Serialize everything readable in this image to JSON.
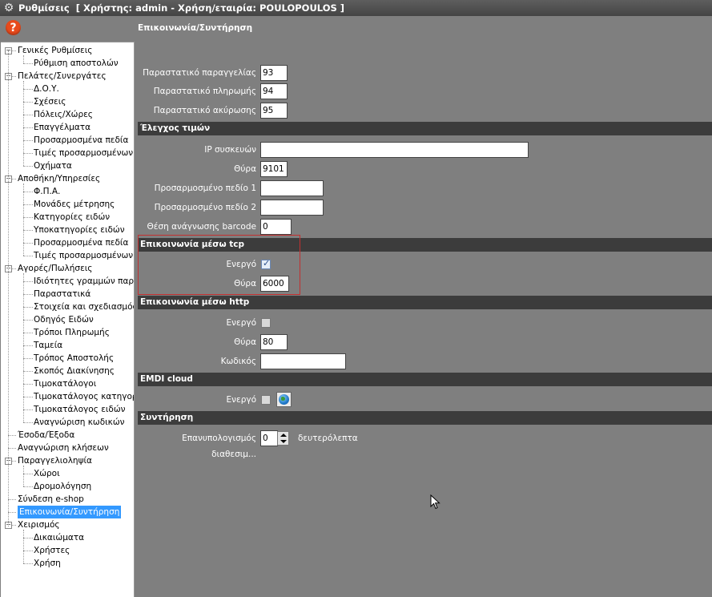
{
  "window": {
    "title": "Ρυθμίσεις",
    "subtitle": "[ Χρήστης: admin - Χρήση/εταιρία: POULOPOULOS ]"
  },
  "header": {
    "help_label": "?",
    "page_title": "Επικοινωνία/Συντήρηση"
  },
  "tree": {
    "items": [
      {
        "label": "Γενικές Ρυθμίσεις"
      },
      {
        "label": "Ρύθμιση αποστολών"
      },
      {
        "label": "Πελάτες/Συνεργάτες"
      },
      {
        "label": "Δ.Ο.Υ."
      },
      {
        "label": "Σχέσεις"
      },
      {
        "label": "Πόλεις/Χώρες"
      },
      {
        "label": "Επαγγέλματα"
      },
      {
        "label": "Προσαρμοσμένα πεδία"
      },
      {
        "label": "Τιμές προσαρμοσμένων π"
      },
      {
        "label": "Οχήματα"
      },
      {
        "label": "Αποθήκη/Υπηρεσίες"
      },
      {
        "label": "Φ.Π.Α."
      },
      {
        "label": "Μονάδες μέτρησης"
      },
      {
        "label": "Κατηγορίες ειδών"
      },
      {
        "label": "Υποκατηγορίες ειδών"
      },
      {
        "label": "Προσαρμοσμένα πεδία"
      },
      {
        "label": "Τιμές προσαρμοσμένων π"
      },
      {
        "label": "Αγορές/Πωλήσεις"
      },
      {
        "label": "Ιδιότητες γραμμών παρασ"
      },
      {
        "label": "Παραστατικά"
      },
      {
        "label": "Στοιχεία και σχεδιασμός π"
      },
      {
        "label": "Οδηγός Ειδών"
      },
      {
        "label": "Τρόποι Πληρωμής"
      },
      {
        "label": "Ταμεία"
      },
      {
        "label": "Τρόπος Αποστολής"
      },
      {
        "label": "Σκοπός Διακίνησης"
      },
      {
        "label": "Τιμοκατάλογοι"
      },
      {
        "label": "Τιμοκατάλογος κατηγοριώ"
      },
      {
        "label": "Τιμοκατάλογος ειδών"
      },
      {
        "label": "Αναγνώριση κωδικών"
      },
      {
        "label": "Έσοδα/Έξοδα"
      },
      {
        "label": "Αναγνώριση κλήσεων"
      },
      {
        "label": "Παραγγελιοληψία"
      },
      {
        "label": "Χώροι"
      },
      {
        "label": "Δρομολόγηση"
      },
      {
        "label": "Σύνδεση e-shop"
      },
      {
        "label": "Επικοινωνία/Συντήρηση"
      },
      {
        "label": "Χειρισμός"
      },
      {
        "label": "Δικαιώματα"
      },
      {
        "label": "Χρήστες"
      },
      {
        "label": "Χρήση"
      }
    ],
    "expander_collapse": "−"
  },
  "form": {
    "order_doc_label": "Παραστατικό παραγγελίας",
    "order_doc_value": "93",
    "payment_doc_label": "Παραστατικό πληρωμής",
    "payment_doc_value": "94",
    "cancel_doc_label": "Παραστατικό ακύρωσης",
    "cancel_doc_value": "95",
    "price_check_header": "Έλεγχος τιμών",
    "ip_label": "IP συσκευών",
    "ip_value": "",
    "port_label": "Θύρα",
    "port_value": "9101",
    "custom1_label": "Προσαρμοσμένο πεδίο 1",
    "custom1_value": "",
    "custom2_label": "Προσαρμοσμένο πεδίο 2",
    "custom2_value": "",
    "barcode_pos_label": "Θέση ανάγνωσης barcode",
    "barcode_pos_value": "0",
    "tcp_header": "Επικοινωνία μέσω tcp",
    "tcp_active_label": "Ενεργό",
    "tcp_active_checked": true,
    "tcp_port_label": "Θύρα",
    "tcp_port_value": "6000",
    "http_header": "Επικοινωνία μέσω http",
    "http_active_label": "Ενεργό",
    "http_active_checked": false,
    "http_port_label": "Θύρα",
    "http_port_value": "80",
    "http_code_label": "Κωδικός",
    "http_code_value": "",
    "emdi_header": "EMDI cloud",
    "emdi_active_label": "Ενεργό",
    "emdi_active_checked": false,
    "maintenance_header": "Συντήρηση",
    "recalc_label": "Επανυπολογισμός διαθεσιμ...",
    "recalc_value": "0",
    "recalc_unit": "δευτερόλεπτα",
    "check_mark": "✓"
  },
  "colors": {
    "background": "#7f7f7f",
    "section_bar": "#3c3c3c",
    "selection": "#3399ff",
    "highlight_border": "#c23030",
    "help_icon": "#e84a1c"
  },
  "icons": {
    "title": "gear-icon",
    "help": "help-icon",
    "emdi": "globe-icon"
  }
}
